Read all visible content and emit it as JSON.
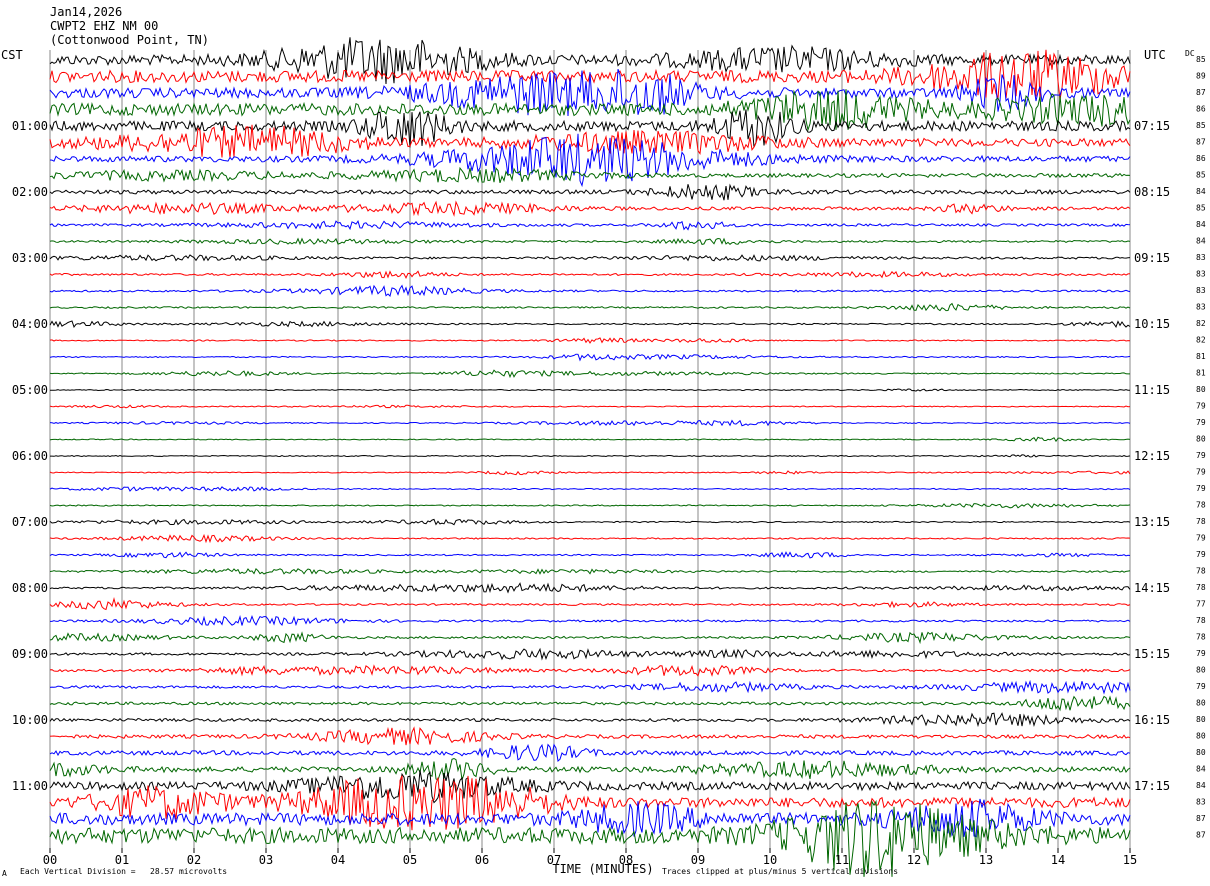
{
  "header": {
    "date": "Jan14,2026",
    "station": "CWPT2 EHZ NM 00",
    "location": "(Cottonwood Point, TN)"
  },
  "left_timezone": "CST",
  "right_timezone": "UTC",
  "dc_label": "DC",
  "footer": {
    "scale_note": "Each Vertical Division =   28.57 microvolts",
    "clip_note": "Traces clipped at plus/minus 5 vertical divisions",
    "corner_mark": "A"
  },
  "colors": {
    "trace_cycle": [
      "#000000",
      "#ff0000",
      "#0000ff",
      "#006600"
    ],
    "grid": "#888888"
  },
  "chart_data": {
    "type": "line",
    "xlabel": "TIME (MINUTES)",
    "xlim": [
      0,
      15
    ],
    "x_ticks": [
      "00",
      "01",
      "02",
      "03",
      "04",
      "05",
      "06",
      "07",
      "08",
      "09",
      "10",
      "11",
      "12",
      "13",
      "14",
      "15"
    ],
    "left_hour_labels": [
      "01:00",
      "02:00",
      "03:00",
      "04:00",
      "05:00",
      "06:00",
      "07:00",
      "08:00",
      "09:00",
      "10:00",
      "11:00"
    ],
    "right_hour_labels": [
      "07:15",
      "08:15",
      "09:15",
      "10:15",
      "11:15",
      "12:15",
      "13:15",
      "14:15",
      "15:15",
      "16:15",
      "17:15"
    ],
    "dc_offsets": [
      85,
      89,
      87,
      86,
      85,
      87,
      86,
      85,
      84,
      85,
      84,
      84,
      83,
      83,
      83,
      83,
      82,
      82,
      81,
      81,
      80,
      79,
      79,
      80,
      79,
      79,
      79,
      78,
      78,
      79,
      79,
      78,
      78,
      77,
      78,
      78,
      79,
      80,
      79,
      80,
      80,
      80,
      80,
      84,
      84,
      83,
      87,
      87
    ],
    "rows": 48,
    "amplitude_level": [
      5,
      6,
      5,
      6,
      5,
      4,
      3,
      2,
      2,
      1.6,
      1.2,
      1,
      1,
      1,
      0.9,
      0.8,
      0.7,
      0.6,
      0.6,
      0.6,
      0.5,
      0.5,
      0.5,
      0.5,
      0.5,
      0.5,
      0.6,
      0.6,
      0.6,
      0.7,
      0.7,
      0.8,
      0.9,
      0.9,
      1,
      1.1,
      1.2,
      1.2,
      1.3,
      1.4,
      1.5,
      1.8,
      2.2,
      2.6,
      4,
      5,
      6,
      8
    ]
  }
}
